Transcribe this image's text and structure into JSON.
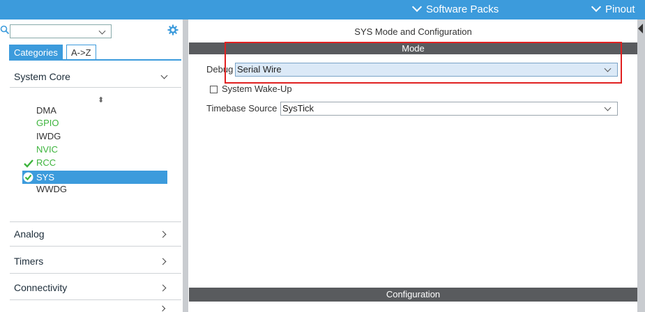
{
  "topbar": {
    "software_packs": "Software Packs",
    "pinout": "Pinout"
  },
  "left": {
    "search": {
      "value": "",
      "placeholder": ""
    },
    "tabs": {
      "categories": "Categories",
      "az": "A->Z"
    },
    "sections": {
      "system_core": "System Core",
      "analog": "Analog",
      "timers": "Timers",
      "connectivity": "Connectivity"
    },
    "sort_glyph": "⬍",
    "peripherals": [
      {
        "name": "DMA",
        "state": "normal"
      },
      {
        "name": "GPIO",
        "state": "green"
      },
      {
        "name": "IWDG",
        "state": "normal"
      },
      {
        "name": "NVIC",
        "state": "green"
      },
      {
        "name": "RCC",
        "state": "green-check"
      },
      {
        "name": "SYS",
        "state": "selected"
      },
      {
        "name": "WWDG",
        "state": "normal"
      }
    ]
  },
  "main": {
    "title": "SYS Mode and Configuration",
    "mode_header": "Mode",
    "debug": {
      "label": "Debug",
      "value": "Serial Wire"
    },
    "wakeup": {
      "label": "System Wake-Up",
      "checked": false
    },
    "timebase": {
      "label": "Timebase Source",
      "value": "SysTick"
    },
    "config_header": "Configuration"
  },
  "colors": {
    "accent": "#3c9bdc",
    "header_bar": "#595b5e",
    "green": "#3db43d",
    "highlight_box": "#e02020"
  },
  "icons": [
    "search-icon",
    "gear-icon",
    "chevron-down-icon",
    "chevron-right-icon",
    "check-icon",
    "check-circle-icon",
    "sort-icon"
  ]
}
